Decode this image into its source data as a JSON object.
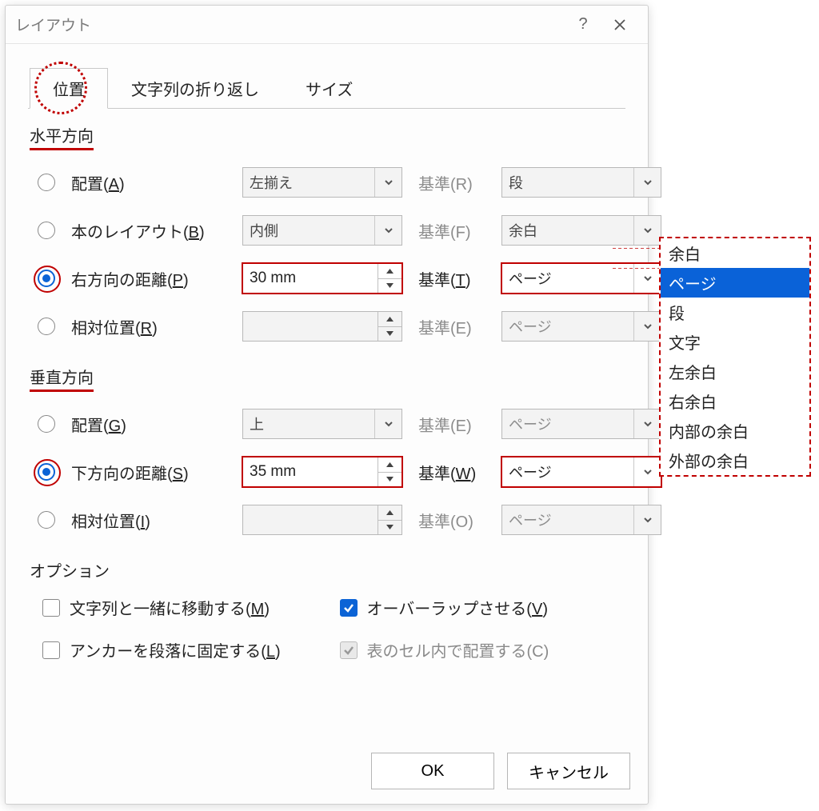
{
  "title": "レイアウト",
  "tabs": {
    "position": "位置",
    "wrap": "文字列の折り返し",
    "size": "サイズ"
  },
  "horizontal": {
    "heading": "水平方向",
    "align": {
      "label": "配置(",
      "key": "A",
      "tail": ")",
      "value": "左揃え",
      "basis_label": "基準(R)",
      "basis_value": "段"
    },
    "book": {
      "label": "本のレイアウト(",
      "key": "B",
      "tail": ")",
      "value": "内側",
      "basis_label": "基準(F)",
      "basis_value": "余白"
    },
    "absolute": {
      "label": "右方向の距離(",
      "key": "P",
      "tail": ")",
      "value": "30 mm",
      "basis_label": "基準(",
      "basis_key": "T",
      "basis_tail": ")",
      "basis_value": "ページ"
    },
    "relative": {
      "label": "相対位置(",
      "key": "R",
      "tail": ")",
      "value": "",
      "basis_label": "基準(E)",
      "basis_value": "ページ"
    }
  },
  "vertical": {
    "heading": "垂直方向",
    "align": {
      "label": "配置(",
      "key": "G",
      "tail": ")",
      "value": "上",
      "basis_label": "基準(E)",
      "basis_value": "ページ"
    },
    "absolute": {
      "label": "下方向の距離(",
      "key": "S",
      "tail": ")",
      "value": "35 mm",
      "basis_label": "基準(",
      "basis_key": "W",
      "basis_tail": ")",
      "basis_value": "ページ"
    },
    "relative": {
      "label": "相対位置(",
      "key": "I",
      "tail": ")",
      "value": "",
      "basis_label": "基準(O)",
      "basis_value": "ページ"
    }
  },
  "options": {
    "heading": "オプション",
    "move": {
      "label": "文字列と一緒に移動する(",
      "key": "M",
      "tail": ")"
    },
    "overlap": {
      "label": "オーバーラップさせる(",
      "key": "V",
      "tail": ")"
    },
    "anchor": {
      "label": "アンカーを段落に固定する(",
      "key": "L",
      "tail": ")"
    },
    "cell": {
      "label": "表のセル内で配置する(C)"
    }
  },
  "footer": {
    "ok": "OK",
    "cancel": "キャンセル"
  },
  "dropdown": {
    "items": [
      "余白",
      "ページ",
      "段",
      "文字",
      "左余白",
      "右余白",
      "内部の余白",
      "外部の余白"
    ],
    "selected_index": 1
  }
}
